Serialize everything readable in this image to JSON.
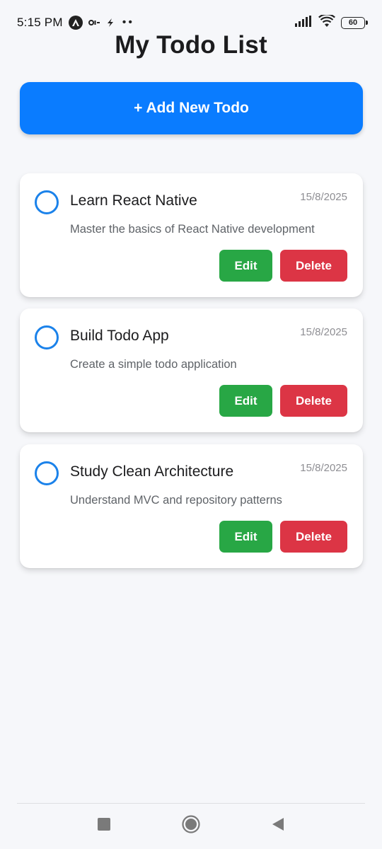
{
  "status_bar": {
    "time": "5:15 PM",
    "battery": "60",
    "left_icons": [
      "a-circle-icon",
      "oi-icon",
      "flash-icon",
      "more-dots-icon"
    ],
    "right_icons": [
      "signal-icon",
      "wifi-icon",
      "battery-icon"
    ],
    "dots": "••"
  },
  "header": {
    "title": "My Todo List"
  },
  "add_button": {
    "label": "+ Add New Todo",
    "color": "#0a7cff"
  },
  "todos": [
    {
      "title": "Learn React Native",
      "description": "Master the basics of React Native development",
      "date": "15/8/2025",
      "completed": false,
      "edit_label": "Edit",
      "delete_label": "Delete"
    },
    {
      "title": "Build Todo App",
      "description": "Create a simple todo application",
      "date": "15/8/2025",
      "completed": false,
      "edit_label": "Edit",
      "delete_label": "Delete"
    },
    {
      "title": "Study Clean Architecture",
      "description": "Understand MVC and repository patterns",
      "date": "15/8/2025",
      "completed": false,
      "edit_label": "Edit",
      "delete_label": "Delete"
    }
  ],
  "colors": {
    "edit": "#28a745",
    "delete": "#dc3545",
    "checkbox": "#1b82ea",
    "background": "#f6f7fa"
  },
  "nav_bar": {
    "icons": [
      "recents-square-icon",
      "home-circle-icon",
      "back-triangle-icon"
    ]
  }
}
